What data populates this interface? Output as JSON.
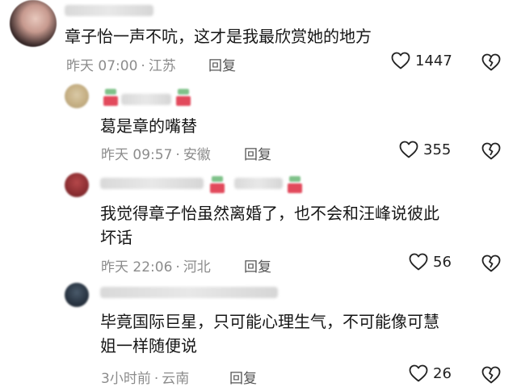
{
  "comments": [
    {
      "text_lines": [
        "章子怡一声不吭，这才是我最欣赏她的地方"
      ],
      "time": "昨天 07:00",
      "location": "江苏",
      "reply_label": "回复",
      "likes": "1447",
      "like_icon": "heart-outline-icon",
      "dislike_icon": "broken-heart-icon"
    },
    {
      "text_lines": [
        "葛是章的嘴替"
      ],
      "time": "昨天 09:57",
      "location": "安徽",
      "reply_label": "回复",
      "likes": "355",
      "like_icon": "heart-outline-icon",
      "dislike_icon": "broken-heart-icon"
    },
    {
      "text_lines": [
        "我觉得章子怡虽然离婚了，也不会和汪峰说彼此",
        "坏话"
      ],
      "time": "昨天 22:06",
      "location": "河北",
      "reply_label": "回复",
      "likes": "56",
      "like_icon": "heart-outline-icon",
      "dislike_icon": "broken-heart-icon"
    },
    {
      "text_lines": [
        "毕竟国际巨星，只可能心理生气，不可能像可慧",
        "姐一样随便说"
      ],
      "time": "3小时前",
      "location": "云南",
      "reply_label": "回复",
      "likes": "26",
      "like_icon": "heart-outline-icon",
      "dislike_icon": "broken-heart-icon"
    }
  ],
  "colors": {
    "text": "#161616",
    "meta": "#8c8c8c",
    "badge_green": "#7fc28a",
    "badge_red": "#e24a5c"
  }
}
